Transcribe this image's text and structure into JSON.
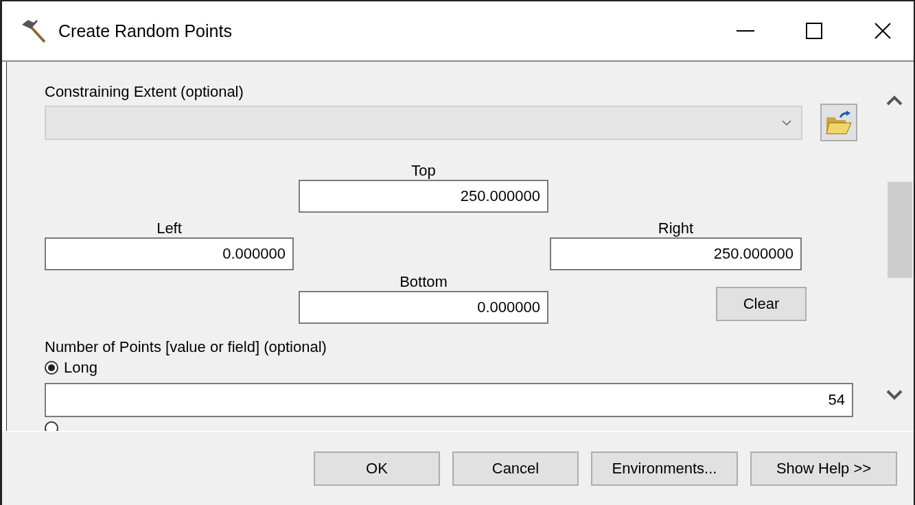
{
  "window": {
    "title": "Create Random Points"
  },
  "extent": {
    "label": "Constraining Extent (optional)",
    "disabled": true,
    "top": {
      "label": "Top",
      "value": "250.000000"
    },
    "left": {
      "label": "Left",
      "value": "0.000000"
    },
    "right": {
      "label": "Right",
      "value": "250.000000"
    },
    "bottom": {
      "label": "Bottom",
      "value": "0.000000"
    },
    "clear_button": "Clear"
  },
  "number_of_points": {
    "label": "Number of Points [value or field] (optional)",
    "options": [
      {
        "label": "Long",
        "selected": true
      },
      {
        "selected": false
      }
    ],
    "value": "54"
  },
  "buttons": [
    "OK",
    "Cancel",
    "Environments...",
    "Show Help >>"
  ]
}
